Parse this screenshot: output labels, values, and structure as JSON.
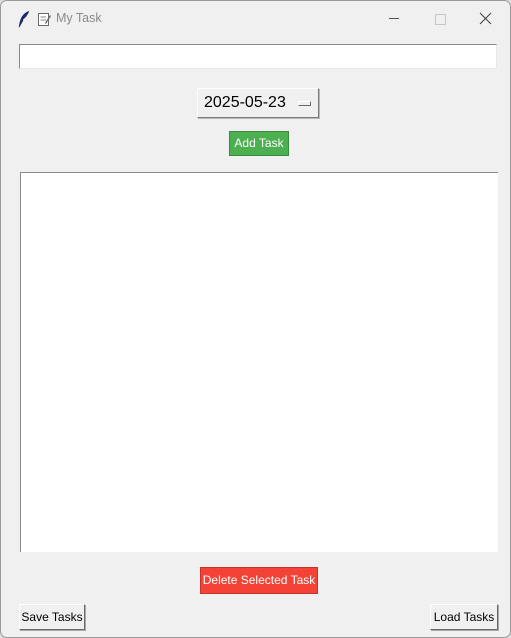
{
  "window": {
    "title": "My Task",
    "icons": [
      "feather-icon",
      "notepad-icon",
      "minimize-icon",
      "maximize-icon",
      "close-icon"
    ]
  },
  "task_entry": {
    "value": ""
  },
  "date_picker": {
    "value": "2025-05-23"
  },
  "buttons": {
    "add": "Add Task",
    "delete": "Delete Selected Task",
    "save": "Save Tasks",
    "load": "Load Tasks"
  },
  "task_list": {
    "items": []
  },
  "colors": {
    "add_button": "#4caf50",
    "delete_button": "#f44336",
    "background": "#f0f0f0"
  }
}
